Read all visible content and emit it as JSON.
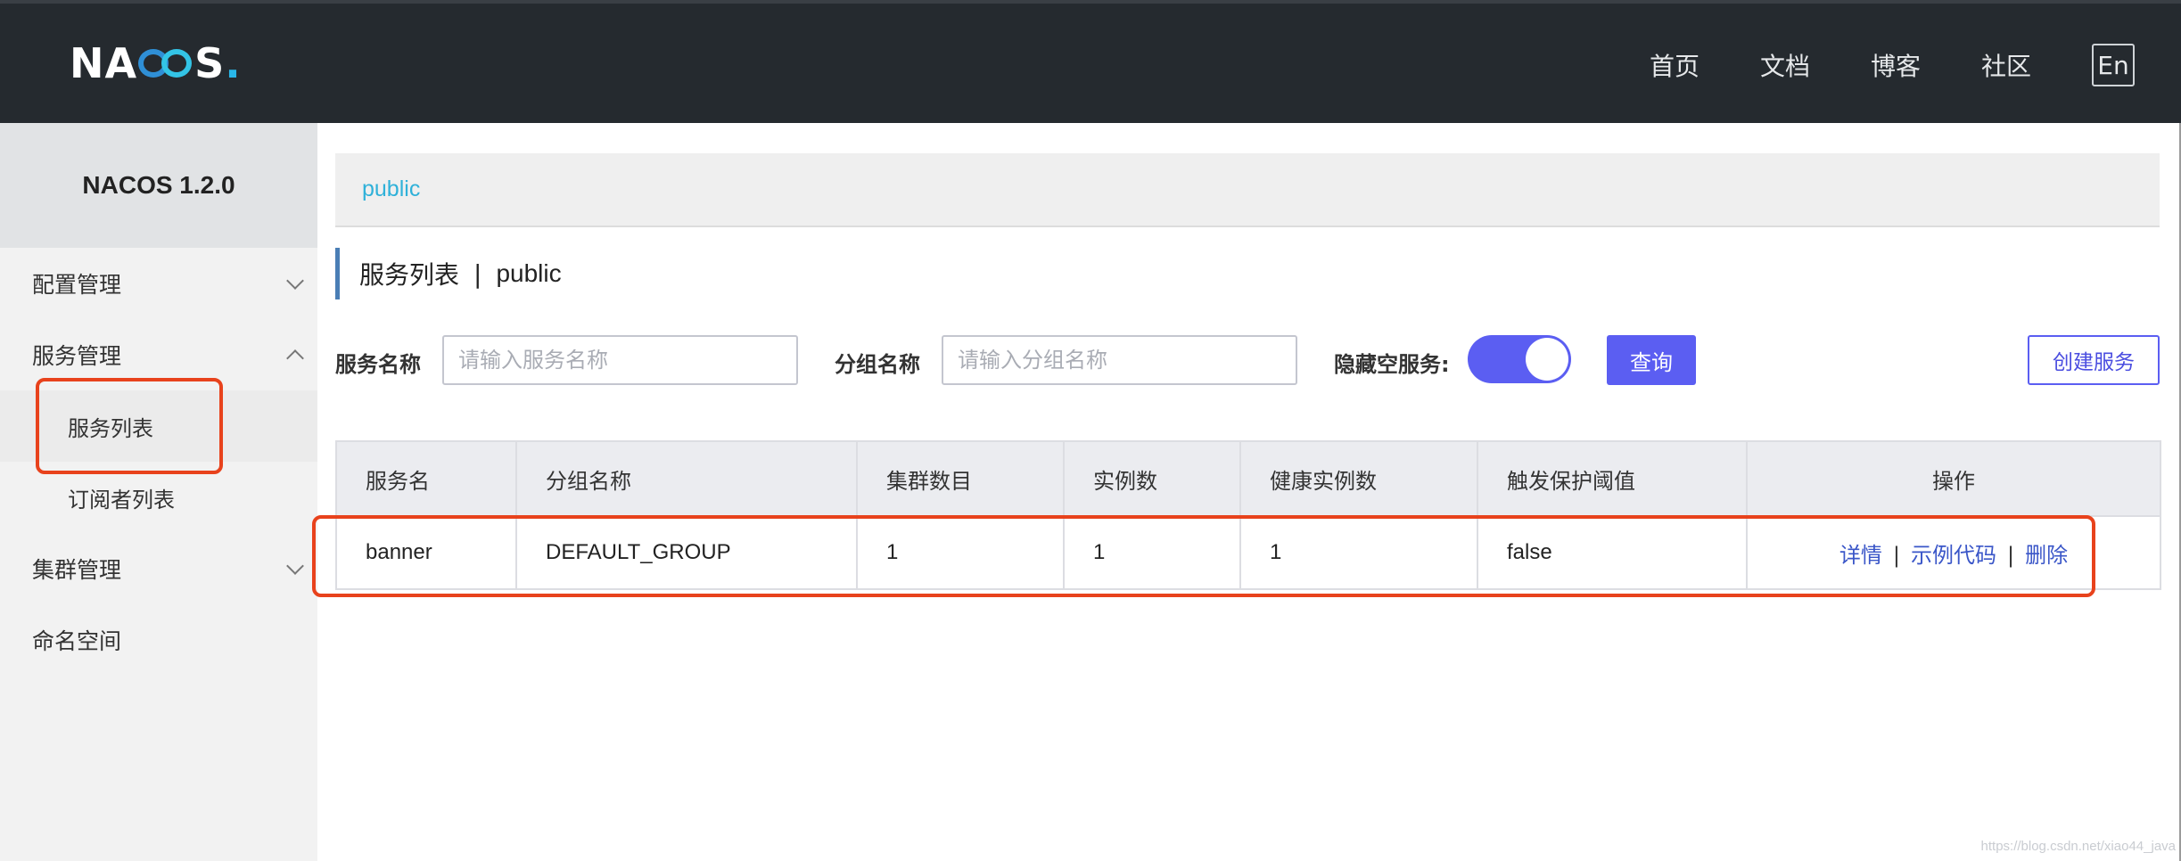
{
  "header": {
    "logo_left": "NA",
    "logo_right": "S",
    "logo_dot": ".",
    "nav": [
      "首页",
      "文档",
      "博客",
      "社区"
    ],
    "lang": "En"
  },
  "sidebar": {
    "version": "NACOS 1.2.0",
    "menu": {
      "config": "配置管理",
      "service": "服务管理",
      "service_list": "服务列表",
      "subscriber_list": "订阅者列表",
      "cluster": "集群管理",
      "namespace": "命名空间"
    }
  },
  "namespace_bar": {
    "label": "public"
  },
  "title": {
    "main": "服务列表",
    "sep": "|",
    "namespace": "public"
  },
  "filters": {
    "service_name_label": "服务名称",
    "service_name_placeholder": "请输入服务名称",
    "group_name_label": "分组名称",
    "group_name_placeholder": "请输入分组名称",
    "hide_empty_label": "隐藏空服务:",
    "hide_empty_on": true,
    "query_button": "查询",
    "create_button": "创建服务"
  },
  "table": {
    "columns": [
      "服务名",
      "分组名称",
      "集群数目",
      "实例数",
      "健康实例数",
      "触发保护阈值",
      "操作"
    ],
    "rows": [
      {
        "service": "banner",
        "group": "DEFAULT_GROUP",
        "clusters": "1",
        "instances": "1",
        "healthy": "1",
        "threshold": "false",
        "actions": [
          "详情",
          "示例代码",
          "删除"
        ]
      }
    ]
  },
  "watermark": "https://blog.csdn.net/xiao44_java",
  "colors": {
    "accent": "#5b5ef2",
    "header_bg": "#252a2f",
    "highlight": "#e8421c",
    "link": "#3a56c8",
    "namespace_text": "#2fb1d9"
  }
}
